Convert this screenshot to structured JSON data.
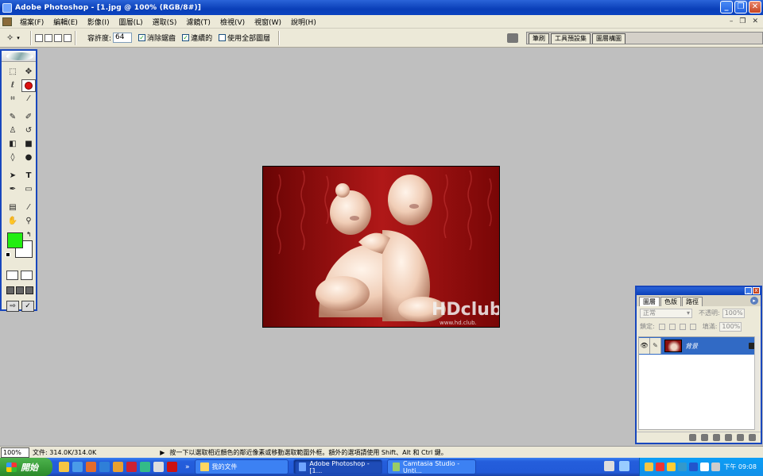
{
  "window": {
    "title": "Adobe Photoshop - [1.jpg @ 100% (RGB/8#)]"
  },
  "menu": {
    "items": [
      "檔案(F)",
      "編輯(E)",
      "影像(I)",
      "圖層(L)",
      "選取(S)",
      "濾鏡(T)",
      "檢視(V)",
      "視窗(W)",
      "說明(H)"
    ]
  },
  "options": {
    "tolerance_label": "容許度:",
    "tolerance_value": "64",
    "anti_alias_label": "消除鋸齒",
    "contiguous_label": "連續的",
    "sample_all_label": "使用全部圖層",
    "anti_alias_checked": true,
    "contiguous_checked": true,
    "sample_all_checked": false
  },
  "palette_well": {
    "tabs": [
      "筆刷",
      "工具預設集",
      "圖層構圖"
    ]
  },
  "toolbox": {
    "foreground_color": "#22ee11",
    "background_color": "#ffffff"
  },
  "layers_panel": {
    "tabs": [
      "圖層",
      "色版",
      "路徑"
    ],
    "blend_mode": "正常",
    "opacity_label": "不透明:",
    "opacity_value": "100%",
    "lock_label": "鎖定:",
    "fill_label": "填滿:",
    "fill_value": "100%",
    "layer": {
      "name": "背景"
    }
  },
  "status": {
    "zoom": "100%",
    "doc_size": "文件: 314.0K/314.0K",
    "hint": "按一下以選取相近顏色的鄰近像素或移動選取範圍外框。額外的選項請使用 Shift、Alt 和 Ctrl 鍵。"
  },
  "taskbar": {
    "start_label": "開始",
    "ql_more": "»",
    "buttons": [
      {
        "label": "我的文件",
        "active": false
      },
      {
        "label": "Adobe Photoshop - [1...",
        "active": true
      },
      {
        "label": "Camtasia Studio - Unti...",
        "active": false
      }
    ],
    "clock": "下午 09:08"
  },
  "image": {
    "watermark": "HDclub",
    "watermark_url": "www.hd.club."
  }
}
